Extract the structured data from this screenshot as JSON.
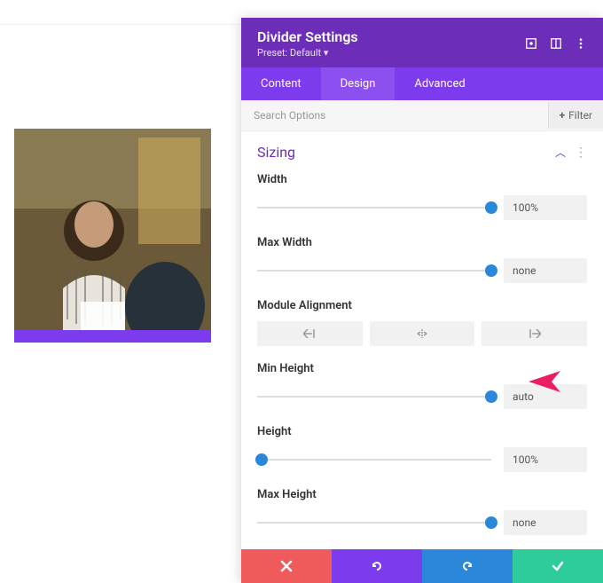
{
  "panel": {
    "title": "Divider Settings",
    "preset_label": "Preset:",
    "preset_value": "Default"
  },
  "tabs": {
    "content": "Content",
    "design": "Design",
    "advanced": "Advanced"
  },
  "search": {
    "placeholder": "Search Options",
    "filter": "Filter"
  },
  "section": {
    "title": "Sizing"
  },
  "fields": {
    "width": {
      "label": "Width",
      "value": "100%",
      "pos": 100
    },
    "max_width": {
      "label": "Max Width",
      "value": "none",
      "pos": 100
    },
    "alignment": {
      "label": "Module Alignment"
    },
    "min_height": {
      "label": "Min Height",
      "value": "auto",
      "pos": 100
    },
    "height": {
      "label": "Height",
      "value": "100%",
      "pos": 2
    },
    "max_height": {
      "label": "Max Height",
      "value": "none",
      "pos": 100
    }
  }
}
